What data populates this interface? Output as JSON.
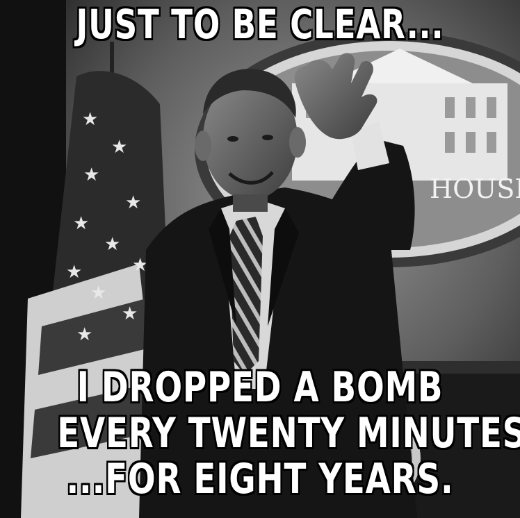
{
  "meme": {
    "top_text": "JUST TO BE CLEAR...",
    "bottom_lines": [
      "I DROPPED A BOMB",
      "EVERY TWENTY MINUTES",
      "...FOR EIGHT YEARS."
    ],
    "seal_text": "HOUSE"
  },
  "colors": {
    "caption_fill": "#ffffff",
    "caption_outline": "#000000"
  }
}
